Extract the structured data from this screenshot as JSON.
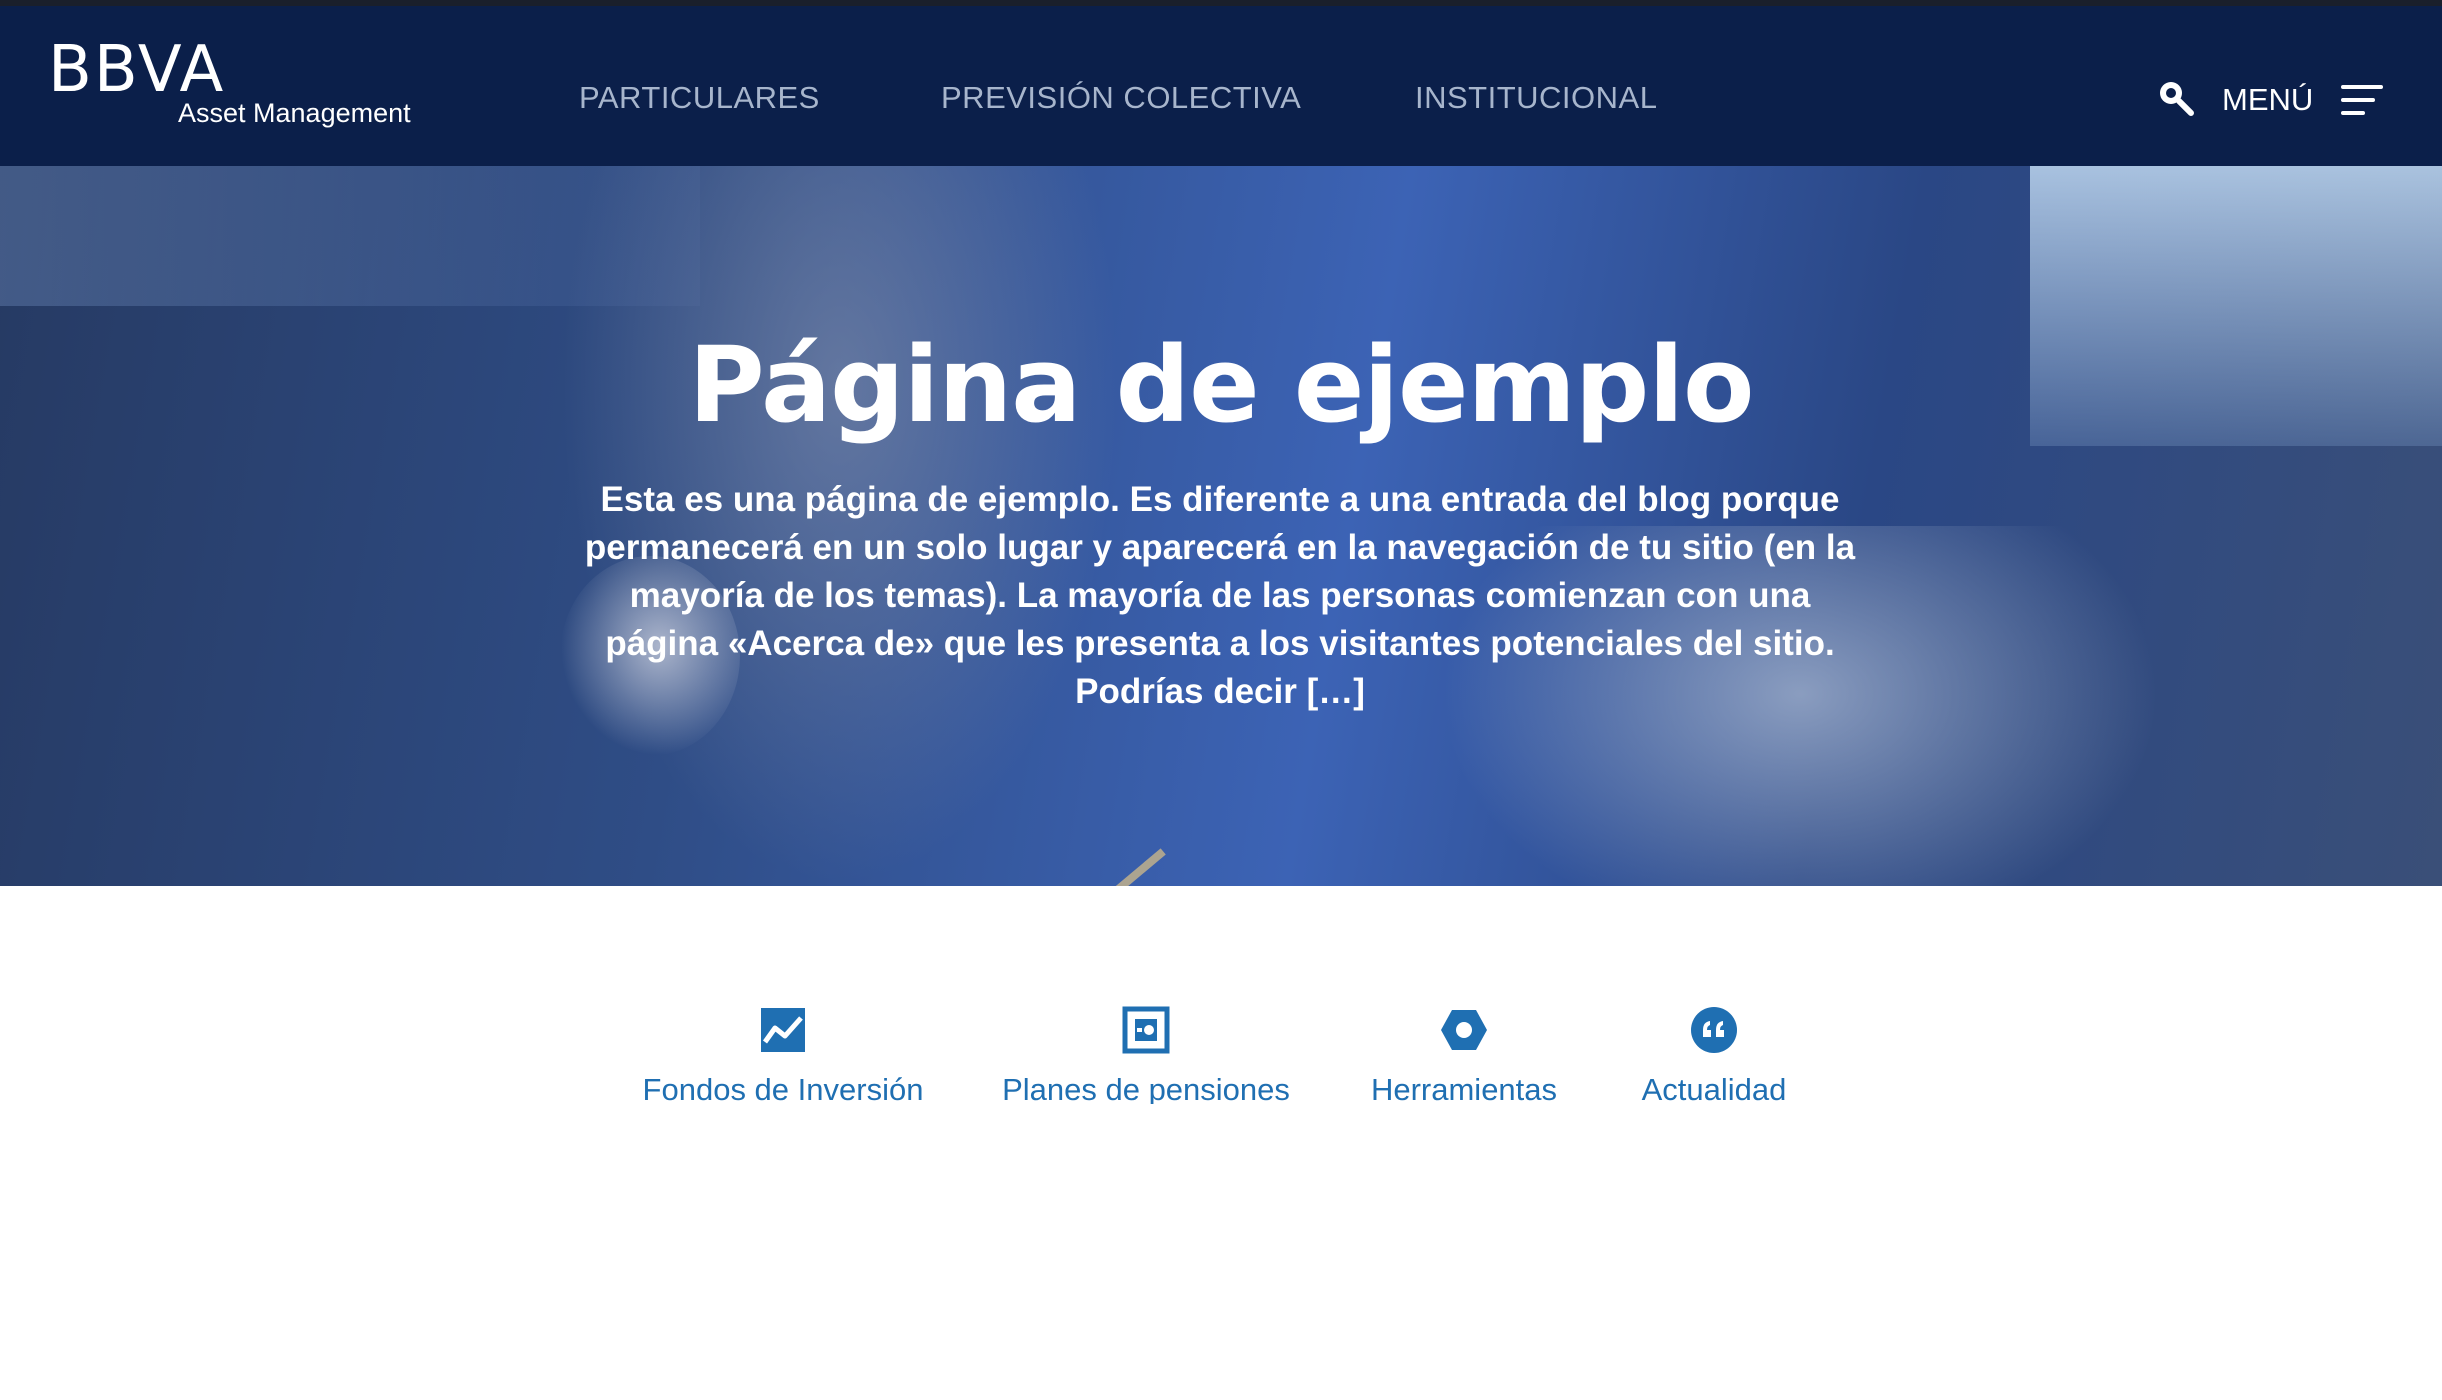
{
  "header": {
    "logo_main": "BBVA",
    "logo_sub": "Asset Management",
    "nav": [
      "PARTICULARES",
      "PREVISIÓN COLECTIVA",
      "INSTITUCIONAL"
    ],
    "search_icon": "search-icon",
    "menu_label": "MENÚ",
    "menu_icon": "hamburger-icon"
  },
  "hero": {
    "title": "Página de ejemplo",
    "text": "Esta es una página de ejemplo. Es diferente a una entrada del blog porque permanecerá en un solo lugar y aparecerá en la navegación de tu sitio (en la mayoría de los temas). La mayoría de las personas comienzan con una página «Acerca de» que les presenta a los visitantes potenciales del sitio. Podrías decir […]"
  },
  "features": [
    {
      "label": "Fondos de Inversión",
      "icon": "chart-line-icon"
    },
    {
      "label": "Planes de pensiones",
      "icon": "piggy-box-icon"
    },
    {
      "label": "Herramientas",
      "icon": "hex-nut-icon"
    },
    {
      "label": "Actualidad",
      "icon": "quote-icon"
    }
  ],
  "colors": {
    "header_bg": "#0b1f4a",
    "nav_text": "#a7b5cc",
    "accent": "#1f6fb2"
  }
}
